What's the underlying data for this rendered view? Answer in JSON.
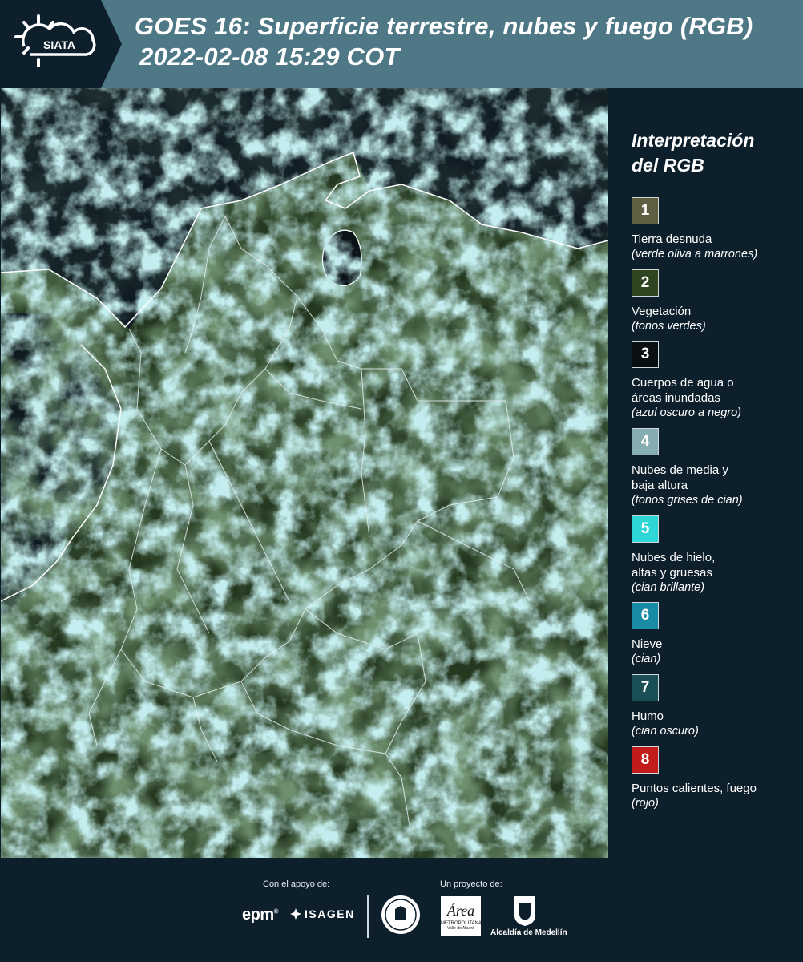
{
  "header": {
    "logo_text": "SIATA",
    "title_line1": "GOES 16: Superficie terrestre, nubes y fuego (RGB)",
    "title_line2": "2022-02-08 15:29 COT"
  },
  "legend": {
    "title_line1": "Interpretación",
    "title_line2": "del RGB",
    "items": [
      {
        "num": "1",
        "label": "Tierra desnuda",
        "desc": "(verde oliva a marrones)",
        "color": "#5f5f44"
      },
      {
        "num": "2",
        "label": "Vegetación",
        "desc": "(tonos verdes)",
        "color": "#2f4420"
      },
      {
        "num": "3",
        "label": "Cuerpos de agua o\náreas inundadas",
        "desc": "(azul oscuro a negro)",
        "color": "#0a0f14"
      },
      {
        "num": "4",
        "label": "Nubes de media y\nbaja altura",
        "desc": "(tonos grises de cian)",
        "color": "#86aeb0"
      },
      {
        "num": "5",
        "label": "Nubes de hielo,\naltas y gruesas",
        "desc": "(cian brillante)",
        "color": "#2fd6d6"
      },
      {
        "num": "6",
        "label": "Nieve",
        "desc": "(cian)",
        "color": "#198ca5"
      },
      {
        "num": "7",
        "label": "Humo",
        "desc": "(cian oscuro)",
        "color": "#1a4f55"
      },
      {
        "num": "8",
        "label": "Puntos calientes, fuego",
        "desc": "(rojo)",
        "color": "#c21b1b"
      }
    ]
  },
  "footer": {
    "support_label": "Con el apoyo de:",
    "project_label": "Un proyecto de:",
    "epm": "epm",
    "isagen": "ISAGEN",
    "amva": "Área",
    "amva_sub": "METROPOLITANA",
    "amva_sub2": "Valle de Aburrá",
    "alcaldia": "Alcaldía de Medellín"
  }
}
